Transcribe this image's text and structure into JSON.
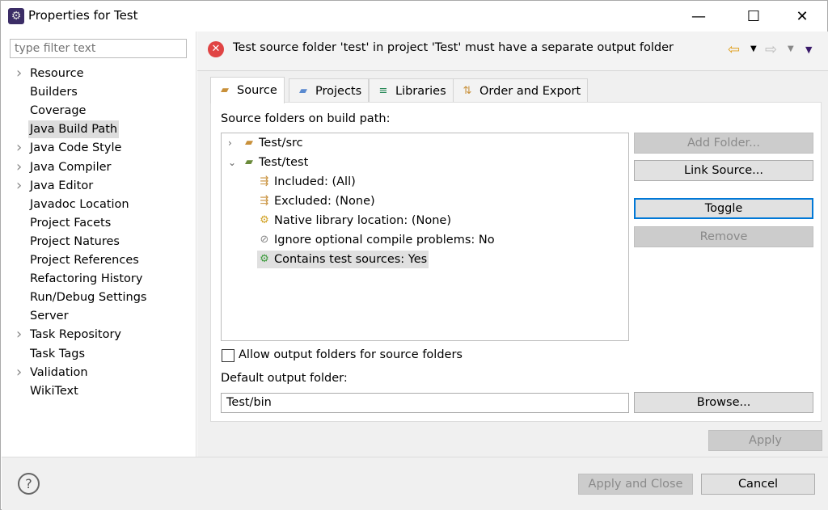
{
  "window": {
    "title": "Properties for Test",
    "minimize": "—",
    "maximize": "☐",
    "close": "✕"
  },
  "filter": {
    "placeholder": "type filter text"
  },
  "nav": [
    {
      "label": "Resource",
      "expandable": true
    },
    {
      "label": "Builders"
    },
    {
      "label": "Coverage"
    },
    {
      "label": "Java Build Path",
      "selected": true
    },
    {
      "label": "Java Code Style",
      "expandable": true
    },
    {
      "label": "Java Compiler",
      "expandable": true
    },
    {
      "label": "Java Editor",
      "expandable": true
    },
    {
      "label": "Javadoc Location"
    },
    {
      "label": "Project Facets"
    },
    {
      "label": "Project Natures"
    },
    {
      "label": "Project References"
    },
    {
      "label": "Refactoring History"
    },
    {
      "label": "Run/Debug Settings"
    },
    {
      "label": "Server"
    },
    {
      "label": "Task Repository",
      "expandable": true
    },
    {
      "label": "Task Tags"
    },
    {
      "label": "Validation",
      "expandable": true
    },
    {
      "label": "WikiText"
    }
  ],
  "message": {
    "text": "Test source folder 'test' in project 'Test' must have a separate output folder",
    "icon": "error-icon"
  },
  "tabs": [
    {
      "label": "Source"
    },
    {
      "label": "Projects"
    },
    {
      "label": "Libraries"
    },
    {
      "label": "Order and Export"
    }
  ],
  "source": {
    "tree_label": "Source folders on build path:",
    "tree": [
      {
        "label": "Test/src",
        "level": 0,
        "expander": "collapsed"
      },
      {
        "label": "Test/test",
        "level": 0,
        "expander": "expanded"
      },
      {
        "label": "Included: (All)",
        "level": 1
      },
      {
        "label": "Excluded: (None)",
        "level": 1
      },
      {
        "label": "Native library location: (None)",
        "level": 1
      },
      {
        "label": "Ignore optional compile problems: No",
        "level": 1
      },
      {
        "label": "Contains test sources: Yes",
        "level": 1,
        "selected": true
      }
    ],
    "buttons": {
      "add_folder": "Add Folder...",
      "link_source": "Link Source...",
      "toggle": "Toggle",
      "remove": "Remove",
      "browse": "Browse..."
    },
    "allow_output_label": "Allow output folders for source folders",
    "allow_output_checked": false,
    "default_output_label": "Default output folder:",
    "default_output_value": "Test/bin"
  },
  "footer": {
    "apply": "Apply",
    "apply_close": "Apply and Close",
    "cancel": "Cancel",
    "help": "?"
  }
}
